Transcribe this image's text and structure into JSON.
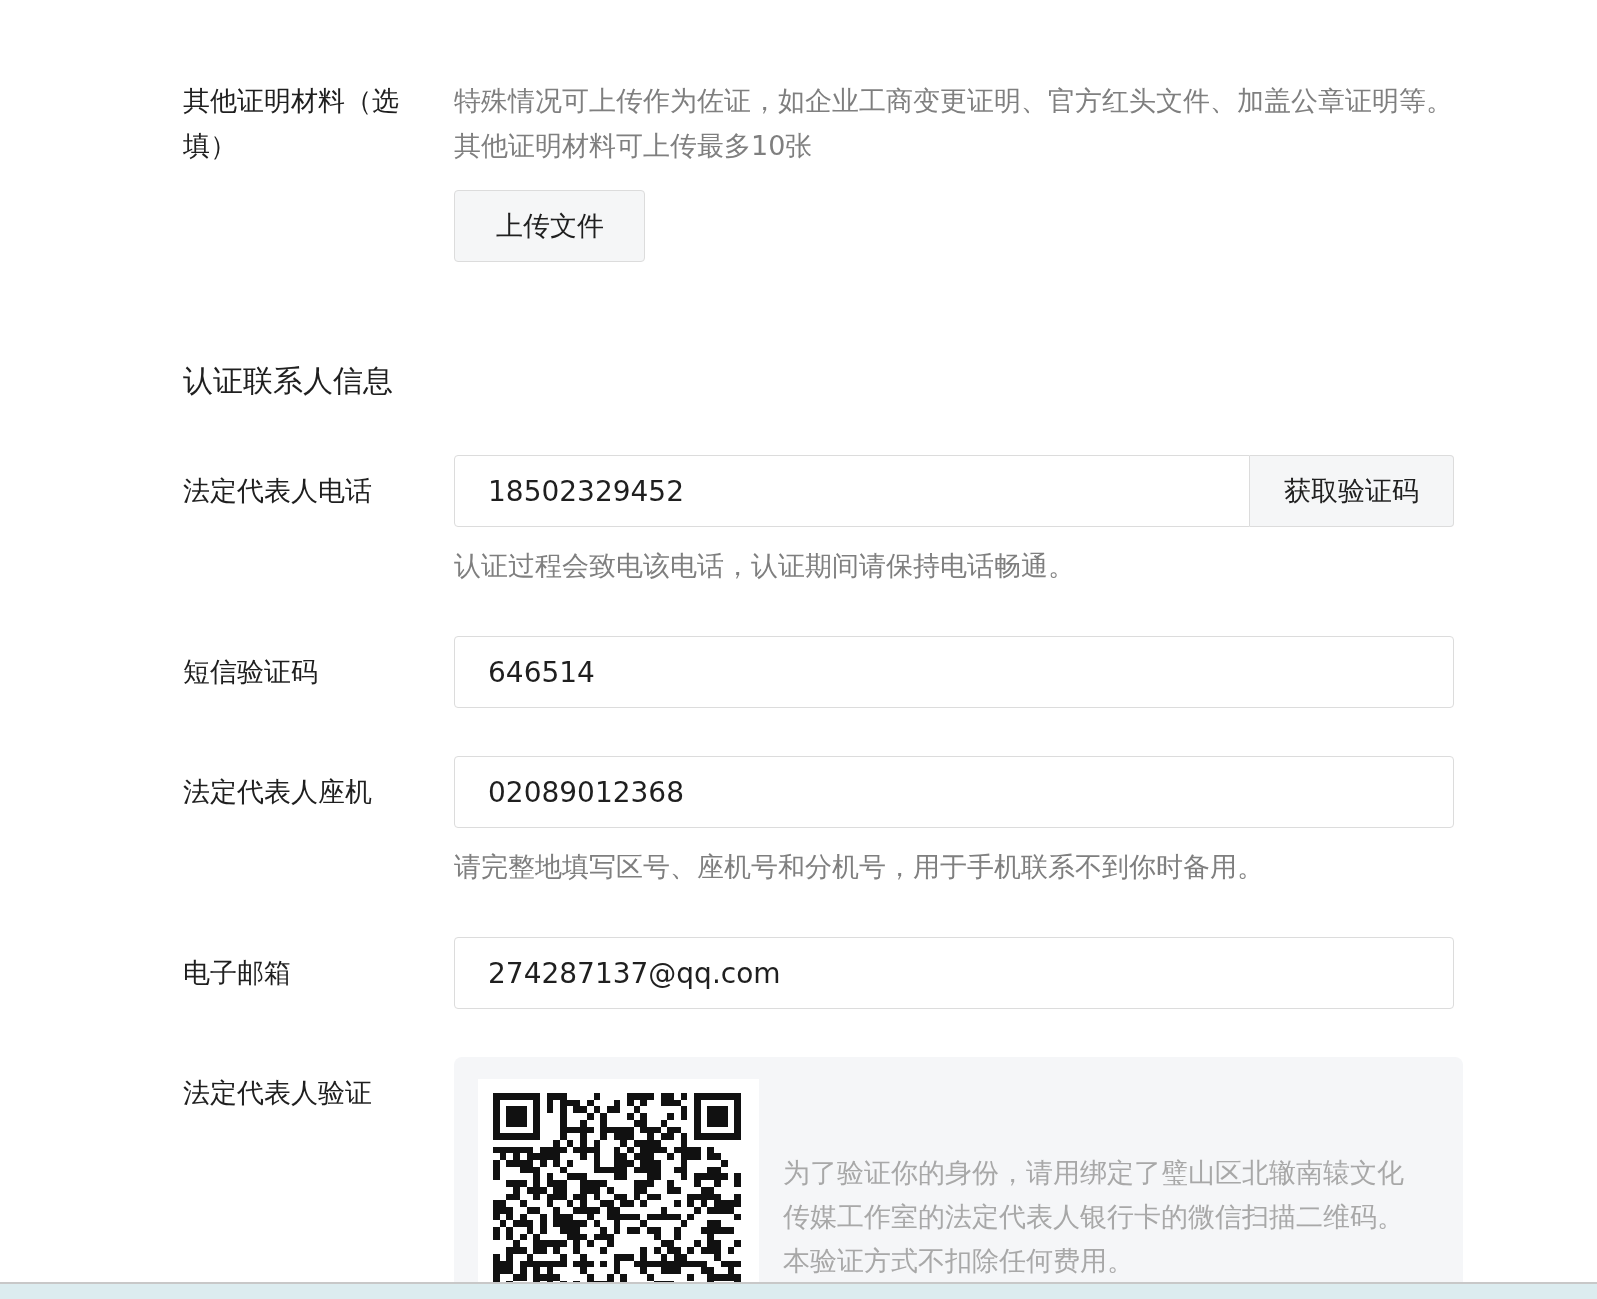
{
  "upload_section": {
    "label": "其他证明材料（选填）",
    "description": "特殊情况可上传作为佐证，如企业工商变更证明、官方红头文件、加盖公章证明等。其他证明材料可上传最多10张",
    "button": "上传文件"
  },
  "section_title": "认证联系人信息",
  "fields": [
    {
      "kind": "with_button",
      "label": "法定代表人电话",
      "value": "18502329452",
      "button": "获取验证码",
      "hint": "认证过程会致电该电话，认证期间请保持电话畅通。"
    },
    {
      "kind": "plain",
      "label": "短信验证码",
      "value": "646514"
    },
    {
      "kind": "plain",
      "label": "法定代表人座机",
      "value": "02089012368",
      "hint": "请完整地填写区号、座机号和分机号，用于手机联系不到你时备用。"
    },
    {
      "kind": "plain",
      "label": "电子邮箱",
      "value": "274287137@qq.com"
    }
  ],
  "verification": {
    "label": "法定代表人验证",
    "lines": [
      "为了验证你的身份，请用绑定了璧山区北辙南辕文化",
      "传媒工作室的法定代表人银行卡的微信扫描二维码。",
      "本验证方式不扣除任何费用。"
    ]
  }
}
